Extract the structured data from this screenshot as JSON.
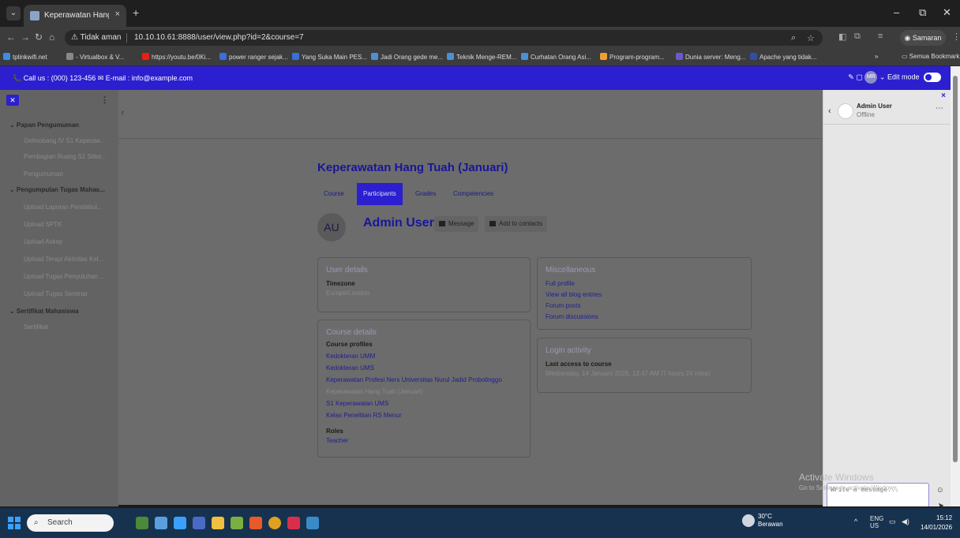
{
  "browser": {
    "tab_title": "Keperawatan Hang Tuah (Janu…",
    "tab_close": "×",
    "new_tab": "+",
    "security_label": "⚠ Tidak aman",
    "url": "10.10.10.61:8888/user/view.php?id=2&course=7",
    "profile_label": "Samaran",
    "window_controls": {
      "minimize": "–",
      "maximize": "⧉",
      "close": "✕"
    },
    "bookmarks": [
      {
        "label": "tplinkwifi.net",
        "color": "#3a8ee6"
      },
      {
        "label": "- Virtualbox & V...",
        "color": "#888888"
      },
      {
        "label": "https://youtu.be/0Ki...",
        "color": "#e62117"
      },
      {
        "label": "power ranger sejak...",
        "color": "#3a6ed8"
      },
      {
        "label": "Yang Suka Main PES...",
        "color": "#3a6ed8"
      },
      {
        "label": "Jadi Orang gede me...",
        "color": "#4a90d9"
      },
      {
        "label": "Teknik Menge-REM...",
        "color": "#4a90d9"
      },
      {
        "label": "Curhatan Orang Asi...",
        "color": "#4a90d9"
      },
      {
        "label": "Program-program...",
        "color": "#f0a030"
      },
      {
        "label": "Dunia server: Meng...",
        "color": "#6a5acd"
      },
      {
        "label": "Apache yang tidak...",
        "color": "#2f4fa0"
      }
    ],
    "bookmarks_more": "»",
    "all_bookmarks": "Semua Bookmark"
  },
  "topbar": {
    "contact": "📞 Call us : (000) 123-456  ✉ E-mail : info@example.com",
    "user_initials": "MR",
    "edit_mode": "Edit mode"
  },
  "drawer": {
    "close": "✕",
    "items": [
      {
        "type": "sec",
        "label": "⌄ Papan Pengumuman"
      },
      {
        "type": "link",
        "label": "Gelmobang IV S1 Keperaw..."
      },
      {
        "type": "link",
        "label": "Pembagian Ruang S1 Stike..."
      },
      {
        "type": "link",
        "label": "Pengumuman"
      },
      {
        "type": "sec",
        "label": "⌄ Pengumpulan Tugas Mahas..."
      },
      {
        "type": "link",
        "label": "Upload Laporan Pendahul..."
      },
      {
        "type": "link",
        "label": "Upload SPTK"
      },
      {
        "type": "link",
        "label": "Upload Askep"
      },
      {
        "type": "link",
        "label": "Upload Terapi Aktivitas Kel..."
      },
      {
        "type": "link",
        "label": "Upload Tugas Penyuluhan ..."
      },
      {
        "type": "link",
        "label": "Upload Tugas Seminar"
      },
      {
        "type": "sec",
        "label": "⌄ Sertifikat Mahasiswa"
      },
      {
        "type": "link",
        "label": "Sertifikat"
      }
    ]
  },
  "main": {
    "header_stub": "r",
    "course_title": "Keperawatan Hang Tuah (Januari)",
    "tabs": [
      "Course",
      "Participants",
      "Grades",
      "Competencies"
    ],
    "active_tab": "Participants",
    "avatar_initials": "AU",
    "user_name": "Admin User",
    "message_btn": "Message",
    "contacts_btn": "Add to contacts",
    "user_details": {
      "title": "User details",
      "timezone_label": "Timezone",
      "timezone_value": "Europe/London"
    },
    "course_details": {
      "title": "Course details",
      "profiles_label": "Course profiles",
      "profiles": [
        {
          "label": "Kedokteran UMM",
          "link": true
        },
        {
          "label": "Kedokteran UMS",
          "link": true
        },
        {
          "label": "Keperawatan Profesi Ners Universitas Nurul Jadid Probolinggo",
          "link": true
        },
        {
          "label": "Keperawatan Hang Tuah (Januari)",
          "link": false
        },
        {
          "label": "S1 Keperawatan UMS",
          "link": true
        },
        {
          "label": "Kelas Penelitian RS Menur",
          "link": true
        }
      ],
      "roles_label": "Roles",
      "roles_value": "Teacher"
    },
    "misc": {
      "title": "Miscellaneous",
      "links": [
        "Full profile",
        "View all blog entries",
        "Forum posts",
        "Forum discussions"
      ]
    },
    "login": {
      "title": "Login activity",
      "last_access_label": "Last access to course",
      "last_access_value": "Wednesday, 14 January 2026, 12:47 AM  (7 hours 24 mins)"
    }
  },
  "message_drawer": {
    "close": "×",
    "name": "Admin User",
    "status": "Offline",
    "placeholder": "Write a message..."
  },
  "watermark": {
    "title": "Activate Windows",
    "subtitle": "Go to Settings to activate Windows."
  },
  "taskbar": {
    "search": "Search",
    "temperature": "30°C",
    "weather": "Berawan",
    "lang": "ENG",
    "region": "US",
    "time": "15:12",
    "date": "14/01/2026",
    "badge": "7"
  }
}
